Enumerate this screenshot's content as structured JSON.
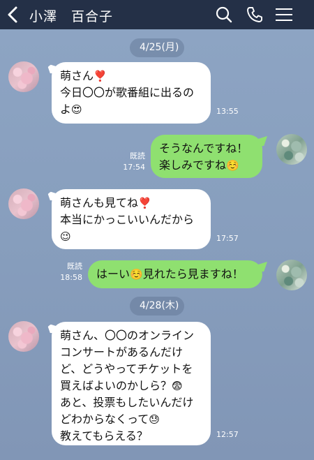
{
  "header": {
    "contact_name": "小澤　百合子",
    "icons": [
      "back-arrow-icon",
      "search-icon",
      "phone-icon",
      "hamburger-menu-icon"
    ]
  },
  "colors": {
    "header_bg": "#243047",
    "chat_bg": "#8ea5c4",
    "incoming_bubble": "#ffffff",
    "outgoing_bubble": "#8fe070"
  },
  "dates": [
    "4/25(月)",
    "4/28(木)"
  ],
  "messages": [
    {
      "direction": "in",
      "lines": [
        {
          "text": "萌さん",
          "emoji": "❣️"
        },
        {
          "text": "今日〇〇が歌番組に出るの",
          "emoji": ""
        },
        {
          "text": "よ",
          "emoji": "😍"
        }
      ],
      "time": "13:55"
    },
    {
      "direction": "out",
      "lines": [
        {
          "text": "そうなんですね！",
          "emoji": ""
        },
        {
          "text": "楽しみですね",
          "emoji": "☺️"
        }
      ],
      "read": "既読",
      "time": "17:54"
    },
    {
      "direction": "in",
      "lines": [
        {
          "text": "萌さんも見てね",
          "emoji": "❣️"
        },
        {
          "text": "本当にかっこいいんだから",
          "emoji": ""
        },
        {
          "text": "",
          "emoji": "😉"
        }
      ],
      "time": "17:57"
    },
    {
      "direction": "out",
      "lines": [
        {
          "text": "はーい",
          "emoji": "☺️",
          "text_after": "見れたら見ますね！"
        }
      ],
      "read": "既読",
      "time": "18:58"
    },
    {
      "direction": "in",
      "lines": [
        {
          "text": "萌さん、〇〇のオンライン",
          "emoji": ""
        },
        {
          "text": "コンサートがあるんだけ",
          "emoji": ""
        },
        {
          "text": "ど、どうやってチケットを",
          "emoji": ""
        },
        {
          "text": "買えばよいのかしら？",
          "emoji": "😨"
        },
        {
          "text": "あと、投票もしたいんだけ",
          "emoji": ""
        },
        {
          "text": "どわからなくって",
          "emoji": "😓"
        },
        {
          "text": "教えてもらえる？",
          "emoji": ""
        }
      ],
      "time": "12:57"
    }
  ]
}
